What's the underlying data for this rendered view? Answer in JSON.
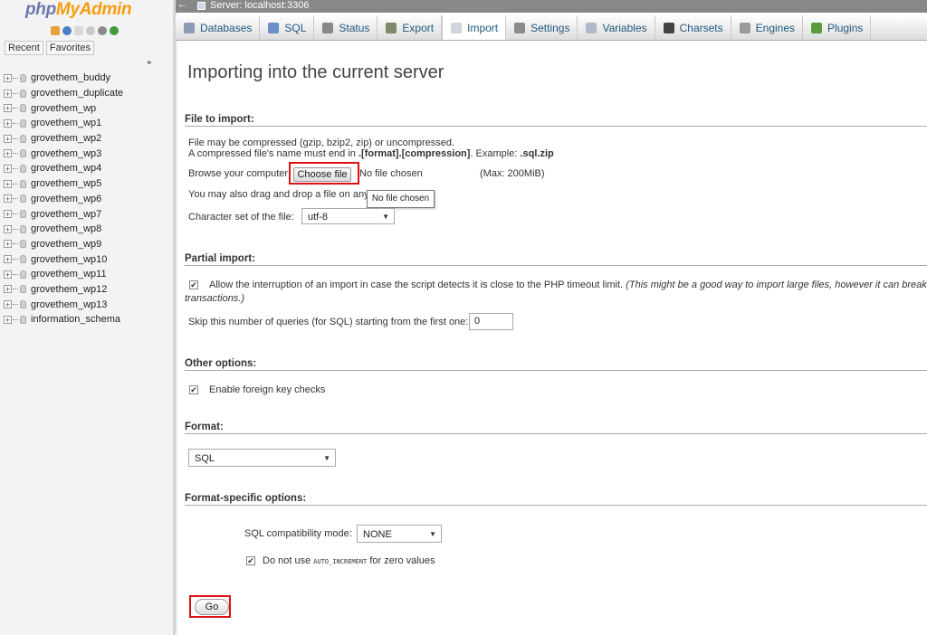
{
  "sidebar": {
    "logo_part1": "php",
    "logo_part2": "MyAdmin",
    "tabs": [
      "Recent",
      "Favorites"
    ],
    "databases": [
      "grovethem_buddy",
      "grovethem_duplicate",
      "grovethem_wp",
      "grovethem_wp1",
      "grovethem_wp2",
      "grovethem_wp3",
      "grovethem_wp4",
      "grovethem_wp5",
      "grovethem_wp6",
      "grovethem_wp7",
      "grovethem_wp8",
      "grovethem_wp9",
      "grovethem_wp10",
      "grovethem_wp11",
      "grovethem_wp12",
      "grovethem_wp13",
      "information_schema"
    ]
  },
  "topbar": {
    "back_arrow": "←",
    "server_label": "Server: localhost:3306"
  },
  "tabs": [
    {
      "label": "Databases",
      "icon": "databases-icon",
      "color": "#8a9bb5"
    },
    {
      "label": "SQL",
      "icon": "sql-icon",
      "color": "#6b8fc7"
    },
    {
      "label": "Status",
      "icon": "status-icon",
      "color": "#888888"
    },
    {
      "label": "Export",
      "icon": "export-icon",
      "color": "#7d8b6a"
    },
    {
      "label": "Import",
      "icon": "import-icon",
      "color": "#cfd6de",
      "active": true
    },
    {
      "label": "Settings",
      "icon": "settings-icon",
      "color": "#8c8c8c"
    },
    {
      "label": "Variables",
      "icon": "variables-icon",
      "color": "#b0b8c8"
    },
    {
      "label": "Charsets",
      "icon": "charsets-icon",
      "color": "#444444"
    },
    {
      "label": "Engines",
      "icon": "engines-icon",
      "color": "#9a9a9a"
    },
    {
      "label": "Plugins",
      "icon": "plugins-icon",
      "color": "#5a9a3a"
    }
  ],
  "main": {
    "title": "Importing into the current server",
    "file_to_import": {
      "legend": "File to import:",
      "compress_note": "File may be compressed (gzip, bzip2, zip) or uncompressed.",
      "name_note_prefix": "A compressed file's name must end in ",
      "name_note_format": ".[format].[compression]",
      "name_note_example": ". Example: ",
      "name_note_ext": ".sql.zip",
      "browse_label": "Browse your computer:",
      "choose_file_button": "Choose file",
      "no_file_chosen": "No file chosen",
      "max_size": "(Max: 200MiB)",
      "drag_drop_note": "You may also drag and drop a file on any p",
      "tooltip": "No file chosen",
      "charset_label": "Character set of the file:",
      "charset_value": "utf-8"
    },
    "partial_import": {
      "legend": "Partial import:",
      "allow_interrupt": "Allow the interruption of an import in case the script detects it is close to the PHP timeout limit.",
      "allow_interrupt_note": "(This might be a good way to import large files, however it can break",
      "allow_interrupt_note2": "transactions.)",
      "skip_label": "Skip this number of queries (for SQL) starting from the first one:",
      "skip_value": "0"
    },
    "other_options": {
      "legend": "Other options:",
      "foreign_key": "Enable foreign key checks"
    },
    "format": {
      "legend": "Format:",
      "value": "SQL"
    },
    "format_specific": {
      "legend": "Format-specific options:",
      "compat_label": "SQL compatibility mode:",
      "compat_value": "NONE",
      "auto_inc_prefix": "Do not use ",
      "auto_inc_code": "AUTO_INCREMENT",
      "auto_inc_suffix": " for zero values"
    },
    "go_button": "Go"
  }
}
